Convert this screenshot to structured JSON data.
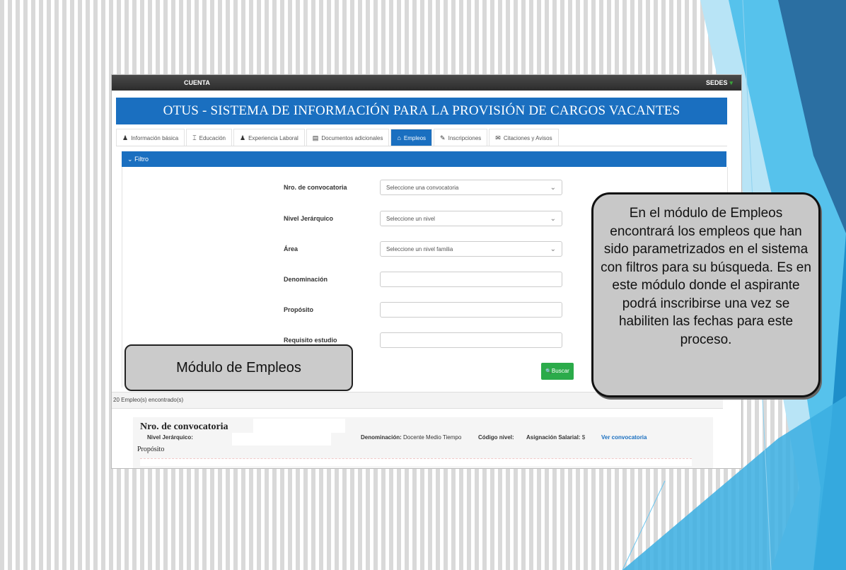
{
  "topbar": {
    "account": "CUENTA",
    "sedes": "SEDES",
    "sedes_caret": "▾"
  },
  "app": {
    "title": "OTUS - SISTEMA DE INFORMACIÓN PARA LA PROVISIÓN DE CARGOS VACANTES"
  },
  "tabs": [
    {
      "label": "Información básica",
      "icon": "person-icon",
      "glyph": "♟"
    },
    {
      "label": "Educación",
      "icon": "graduation-icon",
      "glyph": "⌶"
    },
    {
      "label": "Experiencia Laboral",
      "icon": "users-icon",
      "glyph": "♟"
    },
    {
      "label": "Documentos adicionales",
      "icon": "document-icon",
      "glyph": "▤"
    },
    {
      "label": "Empleos",
      "icon": "building-icon",
      "glyph": "⌂"
    },
    {
      "label": "Inscripciones",
      "icon": "pencil-icon",
      "glyph": "✎"
    },
    {
      "label": "Citaciones y Avisos",
      "icon": "envelope-icon",
      "glyph": "✉"
    }
  ],
  "filter": {
    "header": "Filtro",
    "header_icon": "⌄",
    "fields": [
      {
        "label": "Nro. de convocatoria",
        "value": "Seleccione una convocatoria",
        "type": "select"
      },
      {
        "label": "Nivel Jerárquico",
        "value": "Seleccione un nivel",
        "type": "select"
      },
      {
        "label": "Área",
        "value": "Seleccione un nivel familia",
        "type": "select"
      },
      {
        "label": "Denominación",
        "value": "",
        "type": "text"
      },
      {
        "label": "Propósito",
        "value": "",
        "type": "text"
      },
      {
        "label": "Requisito estudio",
        "value": "",
        "type": "text"
      }
    ],
    "search_label": "Buscar",
    "search_icon": "🔍"
  },
  "results": {
    "count_text": "20 Empleo(s) encontrado(s)",
    "card": {
      "convocatoria_label": "Nro. de convocatoria",
      "nivel_label": "Nivel Jerárquico:",
      "denominacion_label": "Denominación:",
      "denominacion_value": "Docente Medio Tiempo",
      "codigo_label": "Código nivel:",
      "asignacion_label": "Asignación Salarial:",
      "asignacion_value": "$",
      "ver_link": "Ver convocatoria",
      "proposito_label": "Propósito"
    }
  },
  "callouts": {
    "left": "Módulo de Empleos",
    "right": "En el módulo de Empleos encontrará los empleos que han sido parametrizados en el sistema con filtros para su búsqueda. Es en este módulo donde el aspirante podrá inscribirse una vez se habiliten las fechas para este proceso."
  },
  "colors": {
    "primary": "#1a6fc0",
    "success": "#2bab4a",
    "deco_light": "#8fd2f0",
    "deco_dark": "#2b6fa2"
  }
}
